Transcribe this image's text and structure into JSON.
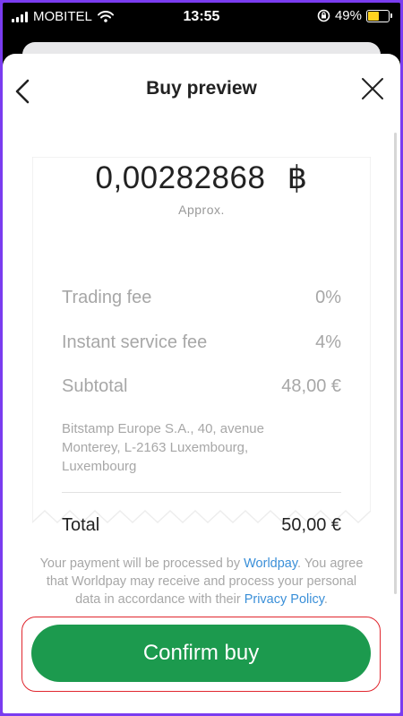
{
  "status_bar": {
    "carrier": "MOBITEL",
    "time": "13:55",
    "battery": "49%"
  },
  "header": {
    "title": "Buy preview"
  },
  "receipt": {
    "amount": "0,00282868",
    "currency_symbol": "฿",
    "approx": "Approx.",
    "rows": [
      {
        "label": "Trading fee",
        "value": "0%"
      },
      {
        "label": "Instant service fee",
        "value": "4%"
      },
      {
        "label": "Subtotal",
        "value": "48,00 €"
      }
    ],
    "address": "Bitstamp Europe S.A., 40, avenue Monterey, L-2163 Luxembourg, Luxembourg",
    "total": {
      "label": "Total",
      "value": "50,00 €"
    }
  },
  "disclaimer": {
    "part1": "Your payment will be processed by ",
    "link1": "Worldpay",
    "part2": ". You agree that Worldpay may receive and process your personal data in accordance with their ",
    "link2": "Privacy Policy",
    "part3": "."
  },
  "confirm_button": {
    "label": "Confirm buy"
  },
  "colors": {
    "accent": "#1c9a4e",
    "link": "#3a8fd8",
    "highlight": "#e0262e",
    "frame": "#7a3cf0"
  }
}
